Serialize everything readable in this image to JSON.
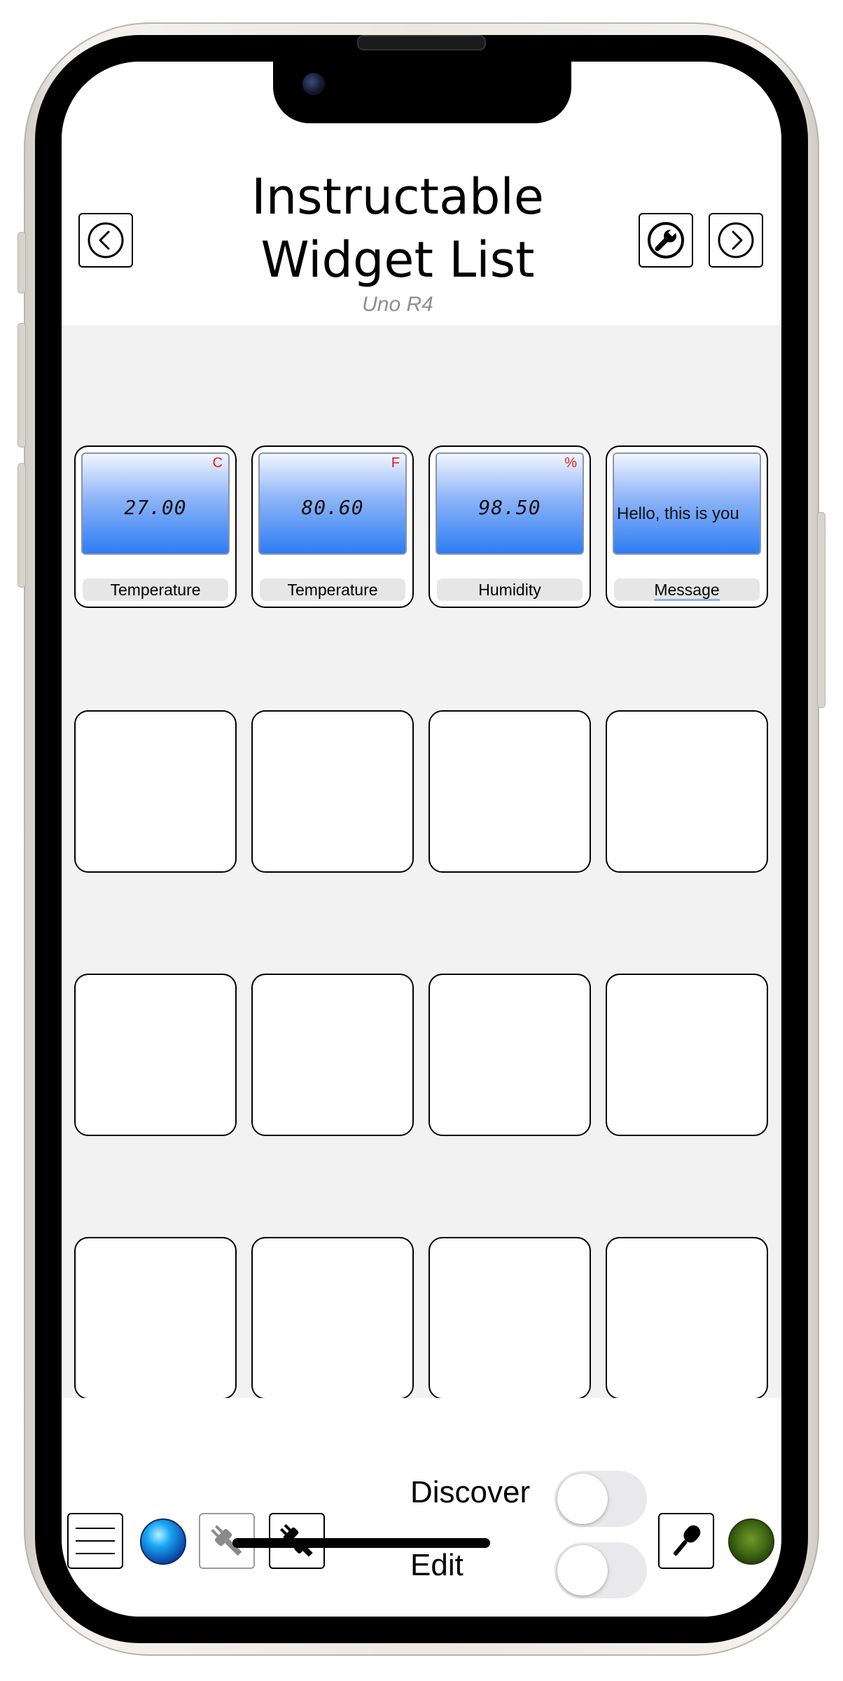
{
  "header": {
    "title_line1": "Instructable",
    "title_line2": "Widget List",
    "subtitle": "Uno R4"
  },
  "widgets": [
    {
      "value": "27.00",
      "unit": "C",
      "label": "Temperature"
    },
    {
      "value": "80.60",
      "unit": "F",
      "label": "Temperature"
    },
    {
      "value": "98.50",
      "unit": "%",
      "label": "Humidity"
    },
    {
      "message": "Hello, this is you",
      "label": "Message"
    }
  ],
  "footer": {
    "discover_label": "Discover",
    "edit_label": "Edit",
    "discover_on": false,
    "edit_on": false
  },
  "icons": {
    "back": "chevron-left-in-circle",
    "settings": "wrench-in-circle",
    "forward": "chevron-right-in-circle",
    "menu": "hamburger",
    "status_led": "blue-led",
    "disconnected_plug": "plug-gray",
    "connect_plug": "plug-black",
    "mic": "microphone",
    "power_led": "green-led"
  },
  "colors": {
    "grid_background": "#f2f2f2",
    "display_top": "#f2f6ff",
    "display_bottom": "#2e7df3",
    "unit_red": "#e0201b",
    "toggle_off": "#e9e9eb"
  }
}
